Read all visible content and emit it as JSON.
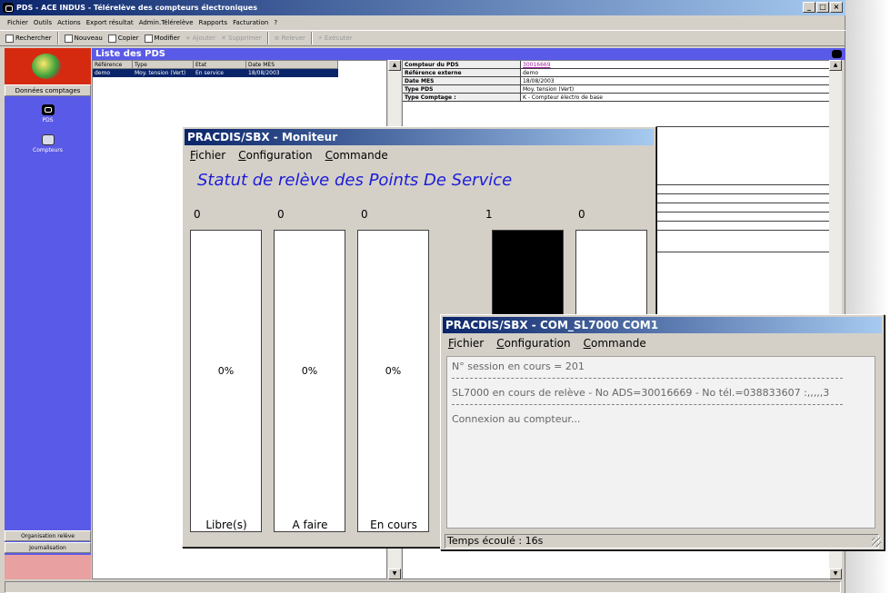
{
  "app": {
    "title": "PDS - ACE INDUS - Télérelève des compteurs électroniques",
    "menu": [
      "Fichier",
      "Outils",
      "Actions",
      "Export résultat",
      "Admin.Télérelève",
      "Rapports",
      "Facturation",
      "?"
    ],
    "toolbar": {
      "search": "Rechercher",
      "new": "Nouveau",
      "copy": "Copier",
      "modify": "Modifier",
      "add": "Ajouter",
      "delete": "Supprimer",
      "read": "Relever",
      "execute": "Exécuter"
    },
    "window_buttons": {
      "min": "_",
      "max": "□",
      "close": "×"
    }
  },
  "sidebar": {
    "section": "Données comptages",
    "items": [
      {
        "label": "PDS",
        "icon": "pds-icon"
      },
      {
        "label": "Compteurs",
        "icon": "meter-icon"
      }
    ],
    "bottom": [
      "Organisation relève",
      "Journalisation"
    ]
  },
  "list": {
    "title": "Liste des PDS",
    "columns": [
      "Référence",
      "Type",
      "Etat",
      "Date MES"
    ],
    "rows": [
      [
        "demo",
        "Moy. tension (Vert)",
        "En service",
        "18/08/2003"
      ]
    ]
  },
  "detail": {
    "rows": [
      {
        "key": "Compteur du PDS",
        "value": "30016669",
        "link": true
      },
      {
        "key": "Référence externe",
        "value": "demo"
      },
      {
        "key": "Date MES",
        "value": "18/08/2003"
      },
      {
        "key": "Type PDS",
        "value": "Moy. tension (Vert)"
      },
      {
        "key": "Type Comptage :",
        "value": "K - Compteur électro de base"
      }
    ]
  },
  "scroll": {
    "up": "▲",
    "down": "▼"
  },
  "moniteur": {
    "title": "PRACDIS/SBX - Moniteur",
    "menu": [
      "Fichier",
      "Configuration",
      "Commande"
    ],
    "heading": "Statut de relève des Points De Service",
    "columns": [
      {
        "count": "0",
        "pct": "0%",
        "label": "Libre(s)"
      },
      {
        "count": "0",
        "pct": "0%",
        "label": "A faire"
      },
      {
        "count": "0",
        "pct": "0%",
        "label": "En cours"
      },
      {
        "count": "1",
        "pct": "",
        "label": ""
      },
      {
        "count": "0",
        "pct": "",
        "label": ""
      }
    ]
  },
  "com": {
    "title": "PRACDIS/SBX - COM_SL7000 COM1",
    "menu": [
      "Fichier",
      "Configuration",
      "Commande"
    ],
    "session": "N° session en cours = 201",
    "reading": "SL7000 en cours de relève - No ADS=30016669 - No tél.=038833607 :,,,,,3",
    "connection": "Connexion au compteur...",
    "status": "Temps écoulé : 16s"
  }
}
